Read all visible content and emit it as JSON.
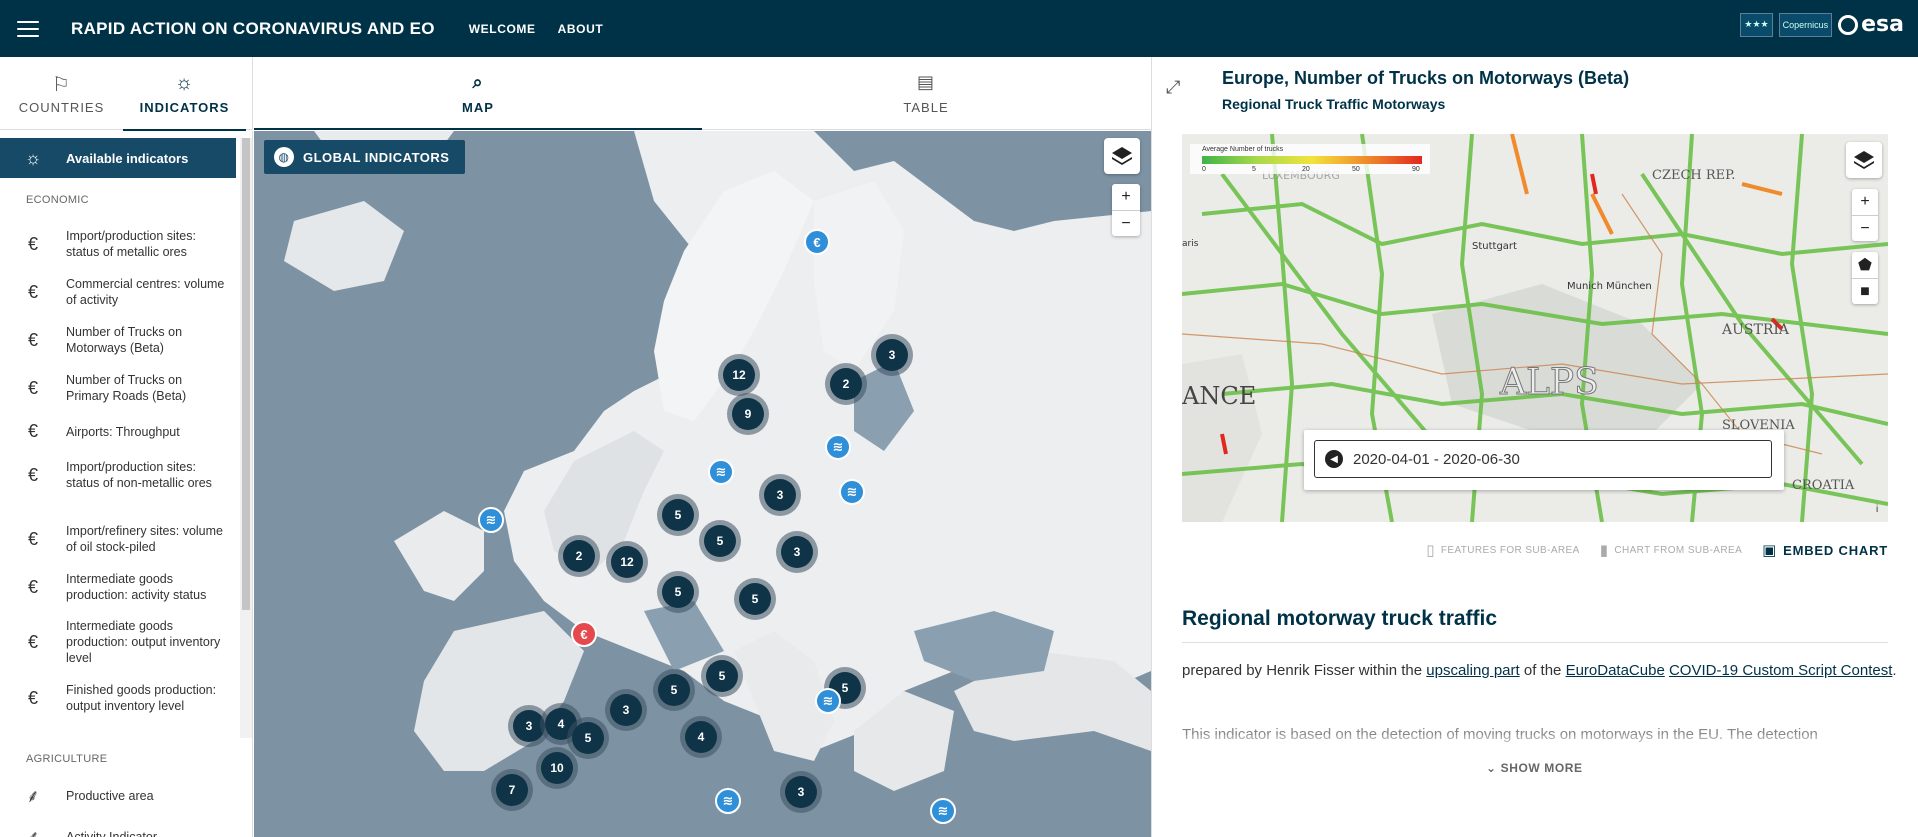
{
  "header": {
    "title": "RAPID ACTION ON CORONAVIRUS AND EO",
    "nav": [
      "WELCOME",
      "ABOUT"
    ],
    "logos": [
      "Copernicus",
      "esa"
    ],
    "bg_color": "#003247"
  },
  "side_tabs": [
    {
      "label": "COUNTRIES",
      "icon": "flag-icon"
    },
    {
      "label": "INDICATORS",
      "icon": "lightbulb-icon"
    }
  ],
  "center_tabs": [
    {
      "label": "MAP",
      "icon": "map-search-icon"
    },
    {
      "label": "TABLE",
      "icon": "table-search-icon"
    }
  ],
  "sidebar": {
    "available_label": "Available indicators",
    "sections": [
      {
        "title": "ECONOMIC",
        "items": [
          "Import/production sites: status of metallic ores",
          "Commercial centres: volume of activity",
          "Number of Trucks on Motorways (Beta)",
          "Number of Trucks on Primary Roads (Beta)",
          "Airports: Throughput",
          "Import/production sites: status of non-metallic ores",
          "Import/refinery sites: volume of oil stock-piled",
          "Intermediate goods production: activity status",
          "Intermediate goods production: output inventory level",
          "Finished goods production: output inventory level"
        ]
      },
      {
        "title": "AGRICULTURE",
        "items": [
          "Productive area",
          "Activity Indicator"
        ]
      }
    ]
  },
  "map": {
    "global_button": "GLOBAL INDICATORS",
    "zoom_in": "+",
    "zoom_out": "−",
    "clusters": [
      "12",
      "2",
      "3",
      "9",
      "3",
      "5",
      "5",
      "2",
      "12",
      "3",
      "5",
      "5",
      "5",
      "5",
      "3",
      "5",
      "3",
      "4",
      "5",
      "4",
      "10",
      "7",
      "3"
    ],
    "markers": [
      {
        "type": "euro",
        "glyph": "€",
        "color": "#2f8fd8"
      },
      {
        "type": "traffic",
        "glyph": "≋",
        "color": "#2f8fd8"
      },
      {
        "type": "traffic",
        "glyph": "≋",
        "color": "#2f8fd8"
      },
      {
        "type": "traffic",
        "glyph": "≋",
        "color": "#2f8fd8"
      },
      {
        "type": "traffic",
        "glyph": "≋",
        "color": "#2f8fd8"
      },
      {
        "type": "euro",
        "glyph": "€",
        "color": "#e5484d"
      },
      {
        "type": "traffic",
        "glyph": "≋",
        "color": "#2f8fd8"
      },
      {
        "type": "traffic",
        "glyph": "≋",
        "color": "#2f8fd8"
      },
      {
        "type": "traffic",
        "glyph": "≋",
        "color": "#2f8fd8"
      }
    ]
  },
  "panel": {
    "title": "Europe, Number of Trucks on Motorways (Beta)",
    "subtitle": "Regional Truck Traffic Motorways",
    "legend": {
      "title": "Average Number of trucks",
      "ticks": [
        "0",
        "5",
        "20",
        "50",
        "90"
      ]
    },
    "place_labels": [
      "CZECH REP.",
      "Stuttgart",
      "Munich München",
      "AUSTRIA",
      "ALPS",
      "ANCE",
      "SLOVENIA",
      "CROATIA",
      "aris",
      "LUXEMBOURG"
    ],
    "date_range": "2020-04-01 - 2020-06-30",
    "map_zoom_in": "+",
    "map_zoom_out": "−",
    "attribution": "i",
    "actions": {
      "features": "FEATURES FOR SUB-AREA",
      "chart": "CHART FROM SUB-AREA",
      "embed": "EMBED CHART"
    },
    "section_heading": "Regional motorway truck traffic",
    "para1": {
      "prefix": "prepared by Henrik Fisser within the ",
      "link1": "upscaling part",
      "mid": " of the ",
      "link2": "EuroDataCube",
      "link3": "COVID-19 Custom Script Contest",
      "suffix": "."
    },
    "para2": "This indicator is based on the detection of moving trucks on motorways in the EU. The detection",
    "show_more": "SHOW MORE"
  }
}
